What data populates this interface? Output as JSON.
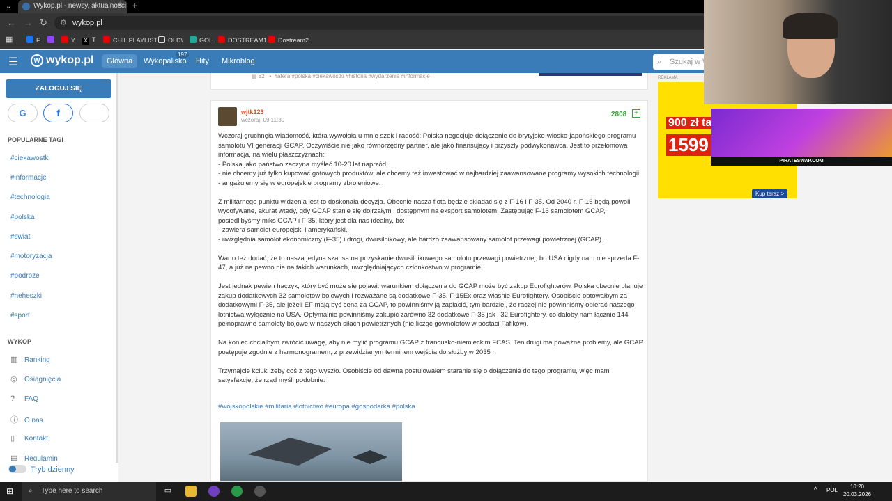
{
  "browser": {
    "tab_title": "Wykop.pl - newsy, aktualności,",
    "tab_close": "✕",
    "new_tab": "+",
    "url": "wykop.pl",
    "bookmarks": [
      {
        "label": "F"
      },
      {
        "label": "Y"
      },
      {
        "label": "T"
      },
      {
        "label": "CHIL PLAYLIST"
      },
      {
        "label": "OLD\\"
      },
      {
        "label": "GOL"
      },
      {
        "label": "DOSTREAM1"
      },
      {
        "label": "Dostream2"
      }
    ]
  },
  "header": {
    "logo": "wykop.pl",
    "logo_mark": "w",
    "nav": [
      "Główna",
      "Wykopalisko",
      "Hity",
      "Mikroblog"
    ],
    "wykopalisko_badge": "197",
    "search_placeholder": "Szukaj w W"
  },
  "sidebar": {
    "login": "ZALOGUJ SIĘ",
    "sso": [
      "G",
      "f",
      ""
    ],
    "popular_title": "POPULARNE TAGI",
    "tags": [
      "#ciekawostki",
      "#informacje",
      "#technologia",
      "#polska",
      "#swiat",
      "#motoryzacja",
      "#podroze",
      "#heheszki",
      "#sport"
    ],
    "wykop_title": "WYKOP",
    "links": [
      "Ranking",
      "Osiągnięcia",
      "FAQ",
      "O nas",
      "Kontakt",
      "Regulamin"
    ],
    "dark_mode": "Tryb dzienny"
  },
  "prev_card": {
    "comments": "82",
    "tags": "#afera   #polska   #ciekawostki   #historia   #wydarzenia   #informacje"
  },
  "post": {
    "username": "wjtk123",
    "time": "wczoraj, 09:11:30",
    "votes": "2808",
    "plus": "+",
    "paragraphs": [
      "Wczoraj gruchnęła wiadomość, która wywołała u mnie szok i radość: Polska negocjuje dołączenie do brytyjsko-włosko-japońskiego programu samolotu VI generacji GCAP. Oczywiście nie jako równorzędny partner, ale jako finansujący i przyszły podwykonawca. Jest to przełomowa informacja, na wielu płaszczyznach:\n- Polska jako państwo zaczyna myśleć 10-20 lat naprzód,\n- nie chcemy już tylko kupować gotowych produktów, ale chcemy też inwestować w najbardziej zaawansowane programy wysokich technologii,\n- angażujemy się w europejskie programy zbrojeniowe.",
      "Z militarnego punktu widzenia jest to doskonała decyzja. Obecnie nasza flota będzie składać się z F-16 i F-35. Od 2040 r. F-16 będą powoli wycofywane, akurat wtedy, gdy GCAP stanie się dojrzałym i dostępnym na eksport samolotem. Zastępując F-16 samolotem GCAP, posiedlibyśmy miks GCAP i F-35, który jest dla nas idealny, bo:\n- zawiera samolot europejski i amerykański,\n- uwzględnia samolot ekonomiczny (F-35) i drogi, dwusilnikowy, ale bardzo zaawansowany samolot przewagi powietrznej (GCAP).",
      "Warto też dodać, że to nasza jedyna szansa na pozyskanie dwusilnikowego samolotu przewagi powietrznej, bo USA nigdy nam nie sprzeda F-47, a już na pewno nie na takich warunkach, uwzględniających członkostwo w programie.",
      "Jest jednak pewien haczyk, który być może się pojawi: warunkiem dołączenia do GCAP może być zakup Eurofighterów. Polska obecnie planuje zakup dodatkowych 32 samolotów bojowych i rozważane są dodatkowe F-35, F-15Ex oraz właśnie Eurofightery. Osobiście optowałbym za dodatkowymi F-35, ale jeżeli EF mają być ceną za GCAP, to powinniśmy ją zapłacić, tym bardziej, że raczej nie powinniśmy opierać naszego lotnictwa wyłącznie na USA. Optymalnie powinniśmy zakupić zarówno 32 dodatkowe F-35 jak i 32 Eurofightery, co dałoby nam łącznie 144 pełnoprawne samoloty bojowe w naszych siłach powietrznych (nie licząc gównolotów w postaci Fafików).",
      "Na koniec chciałbym zwrócić uwagę, aby nie mylić programu GCAP z francusko-niemieckim FCAS. Ten drugi ma poważne problemy, ale GCAP postępuje zgodnie z harmonogramem, z przewidzianym terminem wejścia do służby w 2035 r.",
      "Trzymajcie kciuki żeby coś z tego wyszło. Osobiście od dawna postulowałem staranie się o dołączenie do tego programu, więc mam satysfakcję, że rząd myśli podobnie."
    ],
    "tags": "#wojskopolskie #militaria #lotnictwo #europa #gospodarka #polska"
  },
  "ad": {
    "label": "REKLAMA",
    "promo": "900 zł ta",
    "price": "1599",
    "cta": "Kup teraz >"
  },
  "overlay": {
    "brand": "PIRATESWAP.COM"
  },
  "taskbar": {
    "search_placeholder": "Type here to search",
    "lang": "POL",
    "time": "10:20",
    "date": "20.03.2026"
  }
}
